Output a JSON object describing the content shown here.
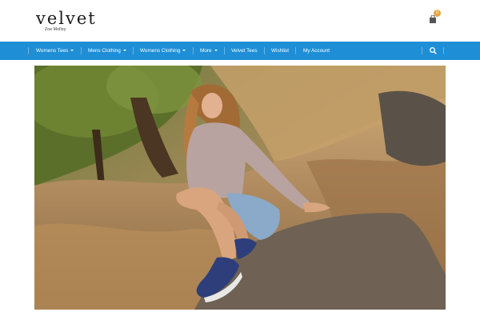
{
  "brand": {
    "name": "velvet",
    "tagline": "Zoe Molloy"
  },
  "cart": {
    "count": "0",
    "icon": "shopping-bag-icon"
  },
  "nav": {
    "items": [
      {
        "label": "Womens Tees",
        "dropdown": true
      },
      {
        "label": "Mens Clothing",
        "dropdown": true
      },
      {
        "label": "Womens Clothing",
        "dropdown": true
      },
      {
        "label": "More",
        "dropdown": true
      },
      {
        "label": "Velvet Tees",
        "dropdown": false
      },
      {
        "label": "Wishlist",
        "dropdown": false
      },
      {
        "label": "My Account",
        "dropdown": false
      }
    ],
    "search_icon": "search-icon"
  },
  "colors": {
    "nav_bg": "#1e8fd6",
    "badge": "#e9a540"
  },
  "hero": {
    "image": "hero-photo-woman-sitting-on-rocky-hillside"
  }
}
